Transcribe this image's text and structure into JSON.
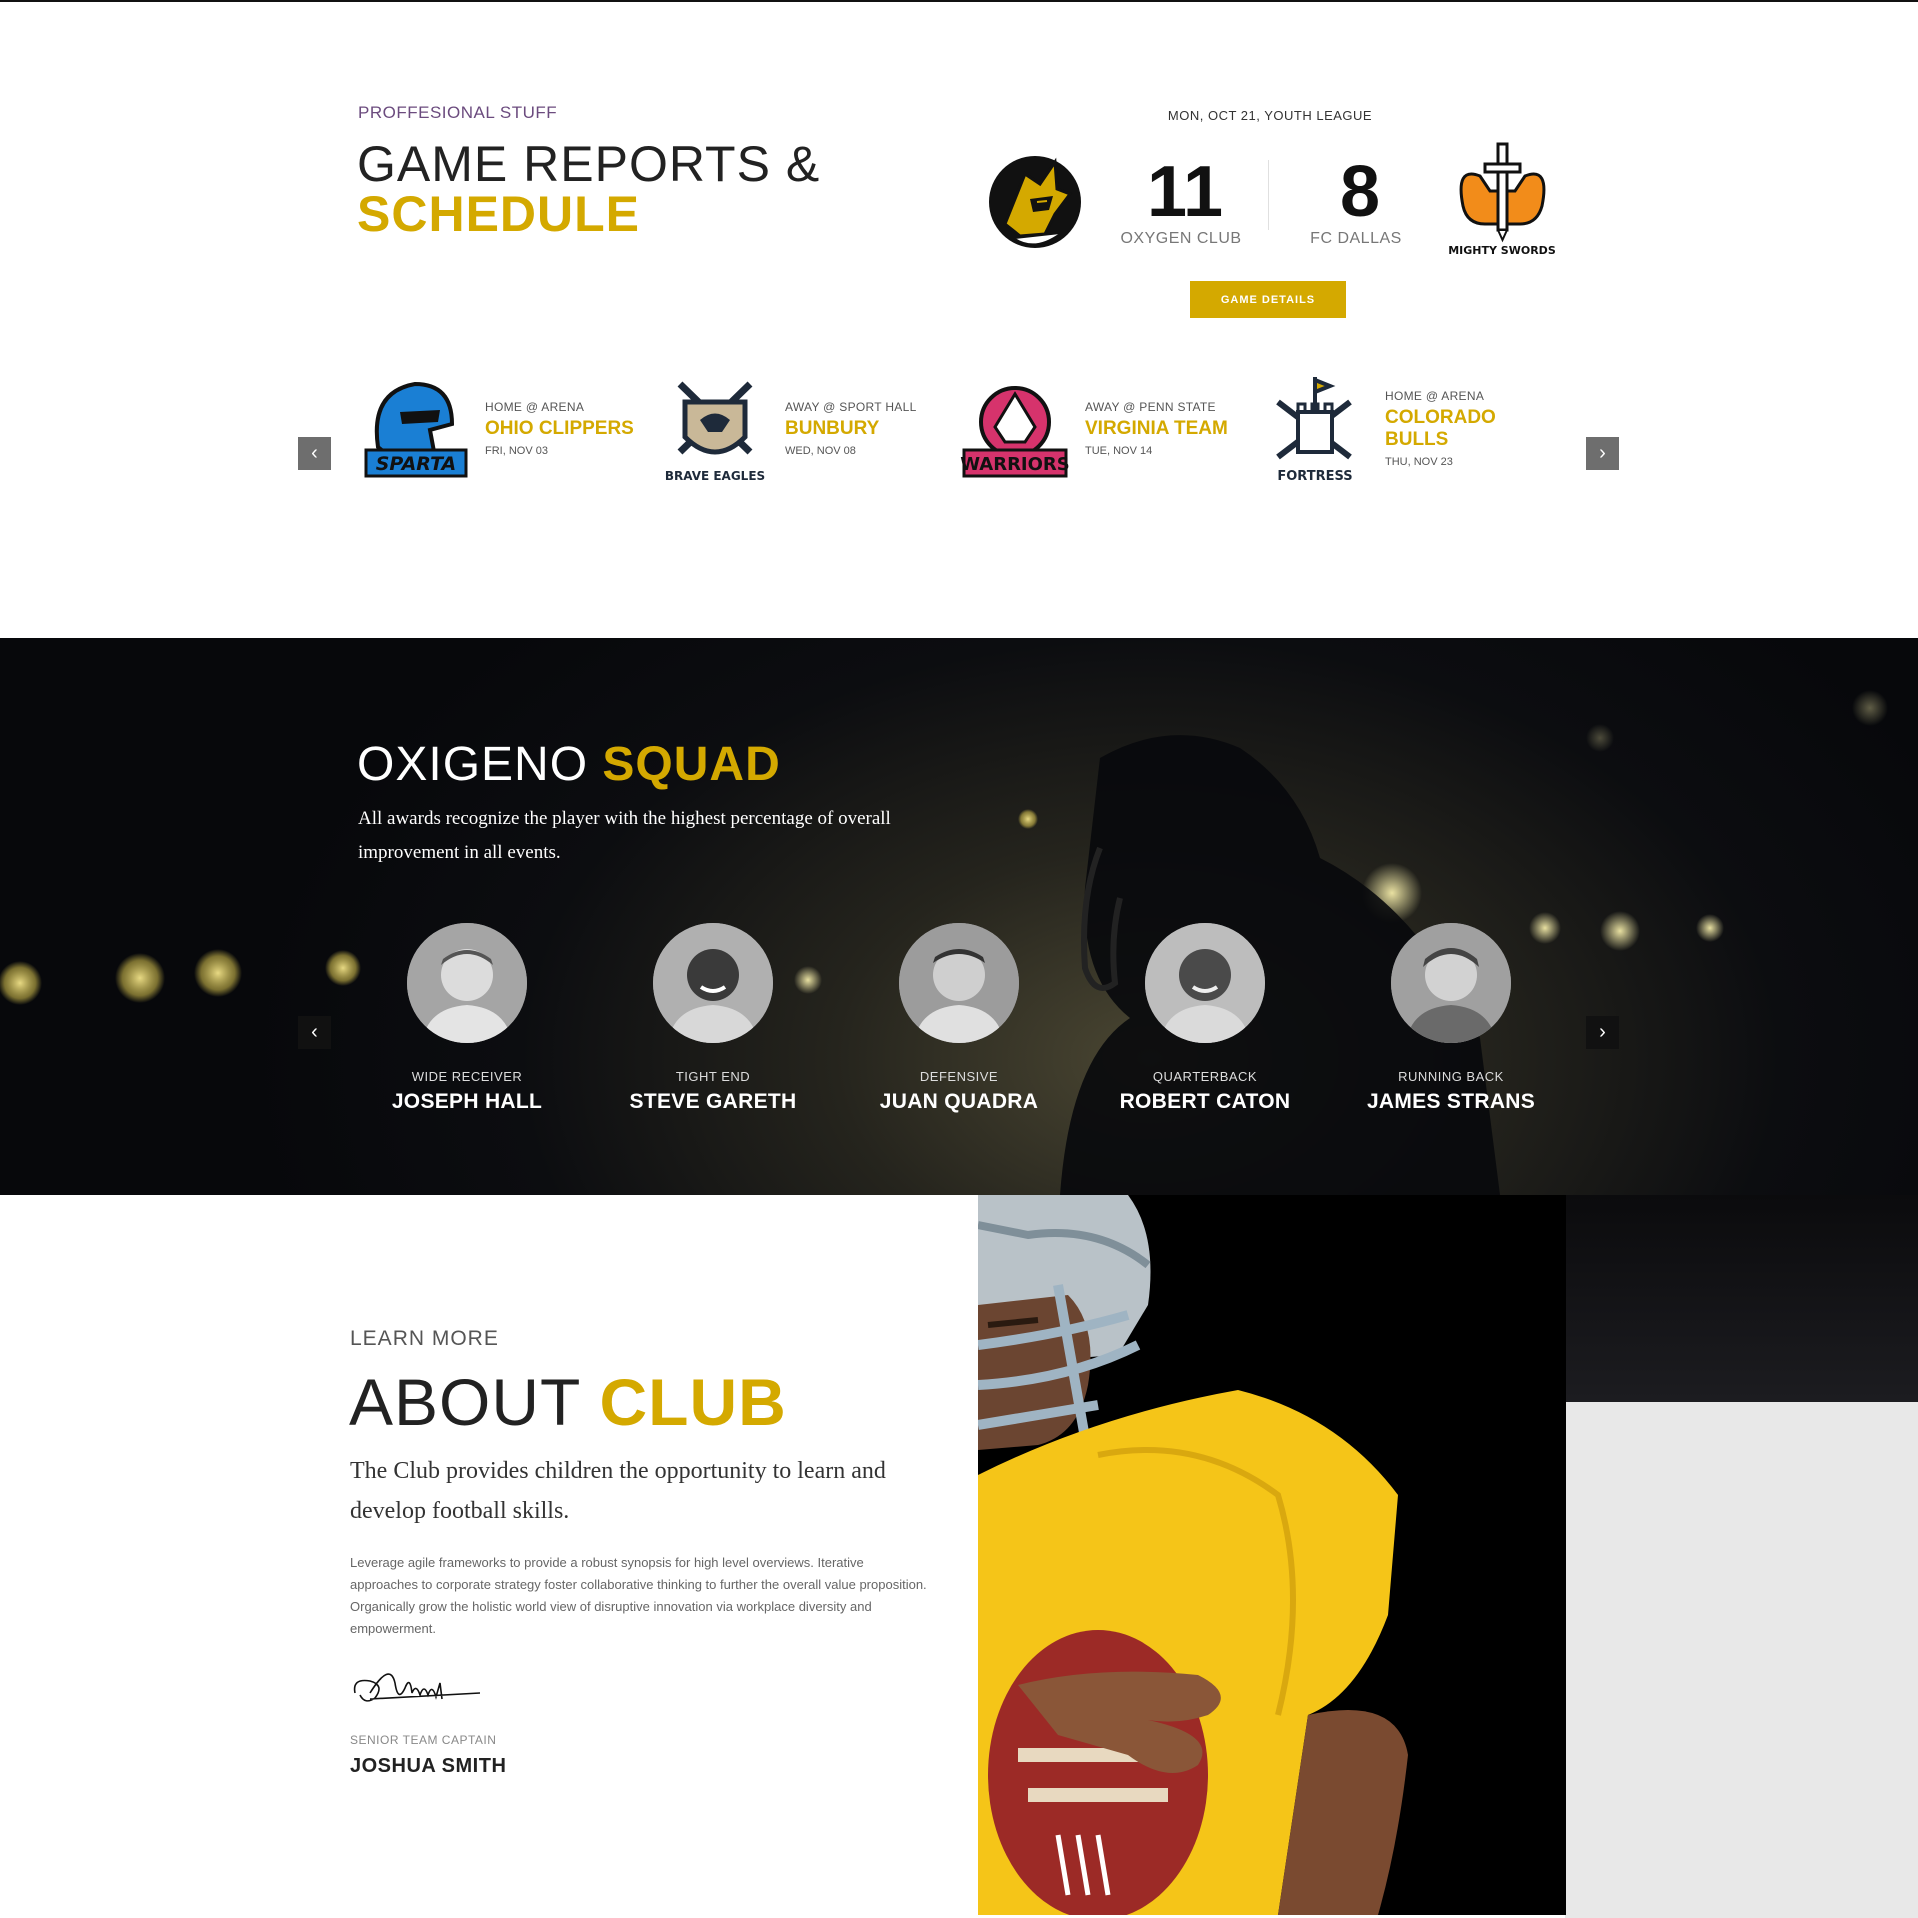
{
  "colors": {
    "accent": "#d4a900",
    "eyebrow": "#6b4b7e",
    "dark": "#0c0d10"
  },
  "schedule": {
    "eyebrow": "PROFFESIONAL STUFF",
    "title_light": "GAME REPORTS &",
    "title_bold": "SCHEDULE",
    "featured": {
      "date": "MON, OCT 21, YOUTH LEAGUE",
      "home": {
        "name": "OXYGEN CLUB",
        "score": "11",
        "logo_icon": "knight-helmet-logo-icon"
      },
      "away": {
        "name": "FC DALLAS",
        "score": "8",
        "logo_icon": "mighty-swords-logo-icon",
        "logo_text": "MIGHTY SWORDS"
      },
      "button": "GAME DETAILS"
    },
    "fixtures": [
      {
        "venue": "HOME @ ARENA",
        "opponent": "OHIO CLIPPERS",
        "date": "FRI, NOV 03",
        "crest_text": "SPARTA",
        "crest_color": "#1a7fd4"
      },
      {
        "venue": "AWAY @ SPORT HALL",
        "opponent": "BUNBURY",
        "date": "WED, NOV 08",
        "crest_text": "BRAVE EAGLES",
        "crest_color": "#1e2a3a"
      },
      {
        "venue": "AWAY @ PENN STATE",
        "opponent": "VIRGINIA TEAM",
        "date": "TUE, NOV 14",
        "crest_text": "WARRIORS",
        "crest_color": "#d6336c"
      },
      {
        "venue": "HOME @ ARENA",
        "opponent": "COLORADO BULLS",
        "date": "THU, NOV 23",
        "crest_text": "FORTRESS",
        "crest_color": "#1e2a3a"
      }
    ],
    "prev_icon": "chevron-left-icon",
    "next_icon": "chevron-right-icon"
  },
  "squad": {
    "title_light": "OXIGENO",
    "title_bold": "SQUAD",
    "description": "All awards recognize the player with the highest percentage of overall improvement in all events.",
    "players": [
      {
        "position": "WIDE RECEIVER",
        "name": "JOSEPH HALL"
      },
      {
        "position": "TIGHT END",
        "name": "STEVE GARETH"
      },
      {
        "position": "DEFENSIVE",
        "name": "JUAN QUADRA"
      },
      {
        "position": "QUARTERBACK",
        "name": "ROBERT CATON"
      },
      {
        "position": "RUNNING BACK",
        "name": "JAMES STRANS"
      }
    ]
  },
  "about": {
    "eyebrow": "LEARN MORE",
    "title_light": "ABOUT",
    "title_bold": "CLUB",
    "lead": "The Club provides children the opportunity to learn and develop football skills.",
    "body": "Leverage agile frameworks to provide a robust synopsis for high level overviews. Iterative approaches to corporate strategy foster collaborative thinking to further the overall value proposition. Organically grow the holistic world view of disruptive innovation via workplace diversity and empowerment.",
    "signer_role": "SENIOR TEAM CAPTAIN",
    "signer_name": "JOSHUA SMITH"
  }
}
